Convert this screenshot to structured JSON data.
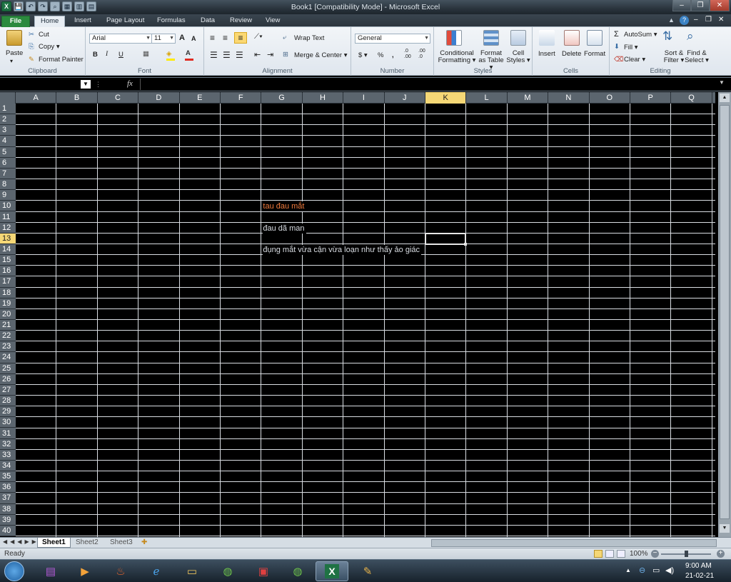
{
  "window": {
    "title": "Book1  [Compatibility Mode]  -  Microsoft Excel",
    "controls": [
      "–",
      "❐",
      "✕"
    ]
  },
  "qat": [
    "X",
    "💾",
    "↶",
    "↷",
    "⌕",
    "▦",
    "▥",
    "▤"
  ],
  "tabs": [
    "File",
    "Home",
    "Insert",
    "Page Layout",
    "Formulas",
    "Data",
    "Review",
    "View"
  ],
  "active_tab": "Home",
  "ribbon": {
    "clipboard": {
      "label": "Clipboard",
      "paste": "Paste",
      "cut": "Cut",
      "copy": "Copy ▾",
      "format_painter": "Format Painter"
    },
    "font": {
      "label": "Font",
      "family": "Arial",
      "size": "11",
      "bold": "B",
      "italic": "I",
      "underline": "U",
      "grow": "A",
      "shrink": "A"
    },
    "alignment": {
      "label": "Alignment",
      "wrap": "Wrap Text",
      "merge": "Merge & Center ▾"
    },
    "number": {
      "label": "Number",
      "format": "General",
      "currency": "$ ▾",
      "percent": "%",
      "comma": ",",
      "inc": ".0 .00",
      "dec": ".00 .0"
    },
    "styles": {
      "label": "Styles",
      "conditional": "Conditional Formatting ▾",
      "format_table": "Format as Table ▾",
      "cell_styles": "Cell Styles ▾"
    },
    "cells": {
      "label": "Cells",
      "insert": "Insert",
      "delete": "Delete",
      "format": "Format"
    },
    "editing": {
      "label": "Editing",
      "autosum": "AutoSum ▾",
      "fill": "Fill ▾",
      "clear": "Clear ▾",
      "sort": "Sort & Filter ▾",
      "find": "Find & Select ▾"
    }
  },
  "formula_bar": {
    "name_box": "",
    "fx": "fx",
    "value": ""
  },
  "columns": [
    "A",
    "B",
    "C",
    "D",
    "E",
    "F",
    "G",
    "H",
    "I",
    "J",
    "K",
    "L",
    "M",
    "N",
    "O",
    "P",
    "Q"
  ],
  "selected_column": "K",
  "rows": [
    "1",
    "2",
    "3",
    "4",
    "5",
    "6",
    "7",
    "8",
    "9",
    "10",
    "11",
    "12",
    "13",
    "14",
    "15",
    "16",
    "17",
    "18",
    "19",
    "20",
    "21",
    "22",
    "23",
    "24",
    "25",
    "26",
    "27",
    "28",
    "29",
    "30",
    "31",
    "32",
    "33",
    "34",
    "35",
    "36",
    "37",
    "38",
    "39",
    "40"
  ],
  "selected_row": "13",
  "cells": [
    {
      "ref": "G10",
      "row": "10",
      "col": "G",
      "text": "tau đau mắt",
      "color": "#f07a3c"
    },
    {
      "ref": "G12",
      "row": "12",
      "col": "G",
      "text": "đau dã man",
      "color": "#d9dde3"
    },
    {
      "ref": "G14",
      "row": "14",
      "col": "G",
      "text": "đụng mắt vừa cận vừa loạn như thấy ảo giác",
      "color": "#d9dde3"
    }
  ],
  "active_cell": "K13",
  "sheets": [
    "Sheet1",
    "Sheet2",
    "Sheet3"
  ],
  "active_sheet": "Sheet1",
  "status": {
    "ready": "Ready",
    "zoom": "100%"
  },
  "taskbar": {
    "apps": [
      "winrar",
      "media-player",
      "fire",
      "internet-explorer",
      "folder",
      "green-app",
      "red-app",
      "green-app-2",
      "excel",
      "paint"
    ],
    "time": "9:00 AM",
    "date": "21-02-21"
  }
}
